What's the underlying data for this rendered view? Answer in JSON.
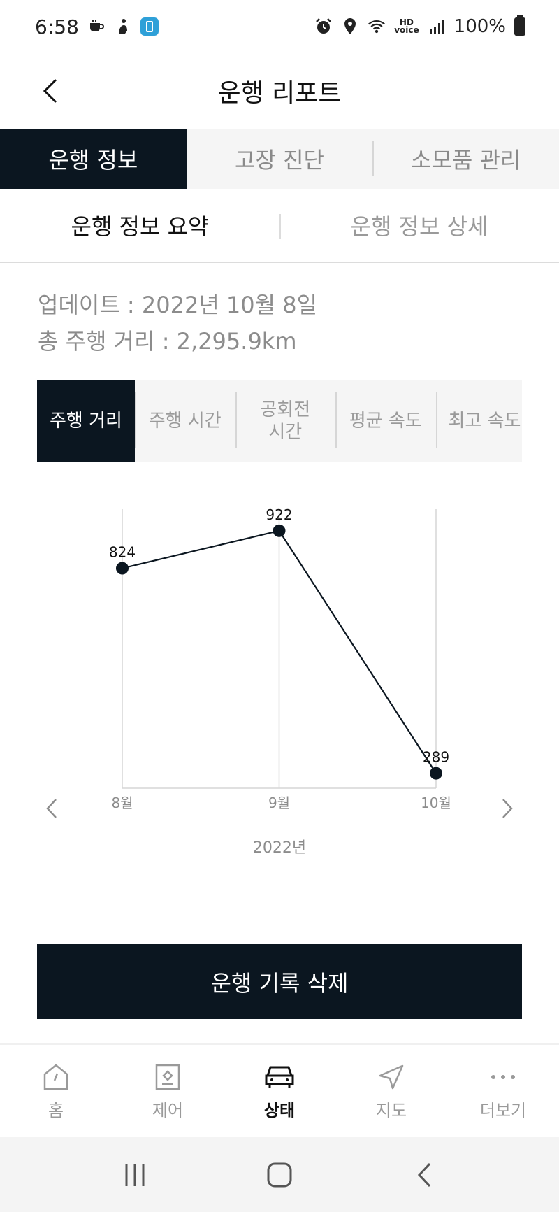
{
  "status_bar": {
    "time": "6:58",
    "hd_top": "HD",
    "hd_bottom": "voice",
    "battery": "100%"
  },
  "header": {
    "title": "운행 리포트"
  },
  "main_tabs": [
    {
      "label": "운행 정보",
      "active": true
    },
    {
      "label": "고장 진단",
      "active": false
    },
    {
      "label": "소모품 관리",
      "active": false
    }
  ],
  "sub_tabs": [
    {
      "label": "운행 정보 요약",
      "active": true
    },
    {
      "label": "운행 정보 상세",
      "active": false
    }
  ],
  "summary": {
    "updated": "업데이트 : 2022년 10월 8일",
    "total_distance": "총 주행 거리 : 2,295.9km"
  },
  "metric_tabs": [
    {
      "label": "주행 거리",
      "active": true
    },
    {
      "label": "주행 시간",
      "active": false
    },
    {
      "label": "공회전 시간",
      "active": false
    },
    {
      "label": "평균 속도",
      "active": false
    },
    {
      "label": "최고 속도",
      "active": false
    }
  ],
  "chart_data": {
    "type": "line",
    "categories": [
      "8월",
      "9월",
      "10월"
    ],
    "values": [
      824,
      922,
      289
    ],
    "data_labels": [
      "824",
      "922",
      "289"
    ],
    "xlabel": "2022년",
    "ylabel": "",
    "ylim": [
      250,
      960
    ],
    "grid": true,
    "line_color": "#0b1620"
  },
  "actions": {
    "delete_label": "운행 기록 삭제"
  },
  "bottom_nav": [
    {
      "label": "홈",
      "icon": "home-icon",
      "active": false
    },
    {
      "label": "제어",
      "icon": "control-icon",
      "active": false
    },
    {
      "label": "상태",
      "icon": "car-icon",
      "active": true
    },
    {
      "label": "지도",
      "icon": "navigation-icon",
      "active": false
    },
    {
      "label": "더보기",
      "icon": "more-icon",
      "active": false
    }
  ],
  "colors": {
    "primary": "#0b1620",
    "muted": "#9a9a9a",
    "tab_bg": "#f5f5f5"
  }
}
